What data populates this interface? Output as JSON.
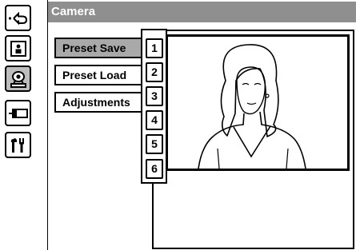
{
  "window": {
    "title": "Camera"
  },
  "sidebar": {
    "items": [
      {
        "name": "back",
        "icon": "back-arrow-icon"
      },
      {
        "name": "user",
        "icon": "person-card-icon"
      },
      {
        "name": "camera",
        "icon": "camera-icon",
        "active": true
      },
      {
        "name": "input",
        "icon": "input-device-icon"
      },
      {
        "name": "settings",
        "icon": "tools-icon"
      }
    ]
  },
  "menu": {
    "items": [
      {
        "label": "Preset Save",
        "selected": true
      },
      {
        "label": "Preset Load",
        "selected": false
      },
      {
        "label": "Adjustments",
        "selected": false
      }
    ]
  },
  "presets": {
    "numbers": [
      "1",
      "2",
      "3",
      "4",
      "5",
      "6"
    ]
  },
  "colors": {
    "title_bar": "#8f8f8f",
    "selected": "#a9a9a9",
    "active_side": "#bdbdbd"
  }
}
